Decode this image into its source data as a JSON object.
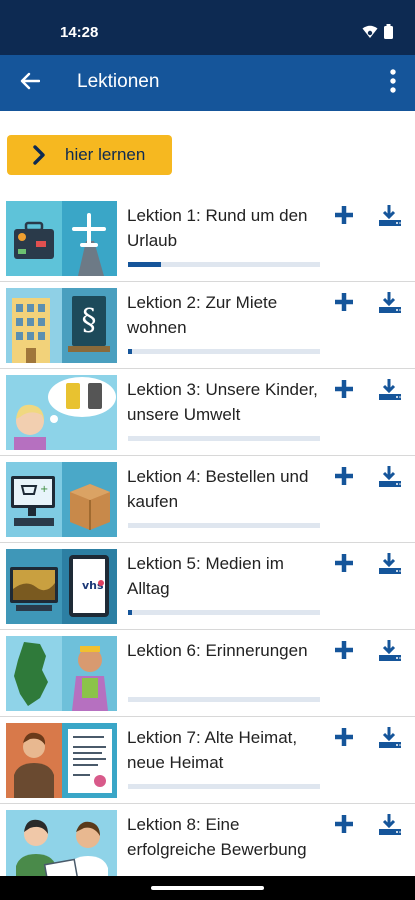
{
  "status_bar": {
    "time": "14:28",
    "icons": [
      "wifi-icon",
      "battery-icon"
    ]
  },
  "app_bar": {
    "title": "Lektionen",
    "back_icon": "arrow-left-icon",
    "menu_icon": "more-vertical-icon"
  },
  "learn_button": {
    "label": "hier lernen",
    "icon": "chevron-right-icon"
  },
  "colors": {
    "status_bar": "#0d2a52",
    "app_bar": "#15559a",
    "accent": "#f6b820",
    "progress": "#15559a",
    "progress_track": "#dfe6ef"
  },
  "lessons": [
    {
      "title": "Lektion 1: Rund um den Urlaub",
      "progress": 0.17,
      "thumb": "suitcase-airplane"
    },
    {
      "title": "Lektion 2: Zur Miete wohnen",
      "progress": 0.02,
      "thumb": "building-law-book"
    },
    {
      "title": "Lektion 3: Unsere Kinder, unsere Umwelt",
      "progress": 0,
      "thumb": "girl-thinking-bins"
    },
    {
      "title": "Lektion 4: Bestellen und kaufen",
      "progress": 0,
      "thumb": "computer-parcel"
    },
    {
      "title": "Lektion 5: Medien im Alltag",
      "progress": 0.02,
      "thumb": "tv-tablet"
    },
    {
      "title": "Lektion 6: Erinnerungen",
      "progress": 0,
      "thumb": "map-woman"
    },
    {
      "title": "Lektion 7: Alte Heimat, neue Heimat",
      "progress": 0,
      "thumb": "man-document"
    },
    {
      "title": "Lektion 8: Eine erfolgreiche Bewerbung",
      "progress": 0,
      "thumb": "interview"
    }
  ]
}
